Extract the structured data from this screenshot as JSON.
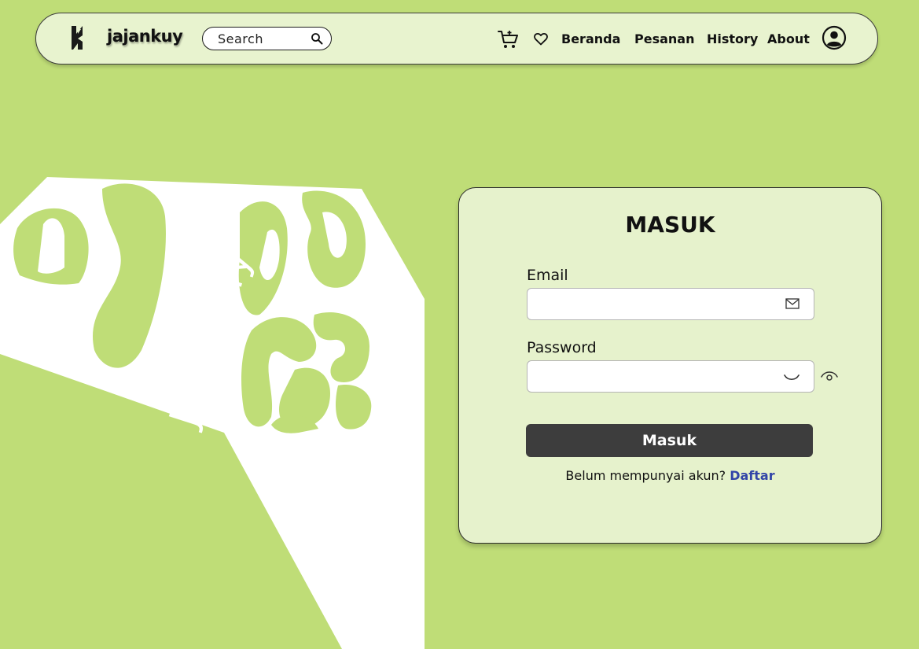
{
  "brand": {
    "name": "jajankuy"
  },
  "search": {
    "placeholder": "Search"
  },
  "nav": {
    "links": [
      "Beranda",
      "Pesanan",
      "History",
      "About"
    ]
  },
  "art": {
    "text": "Jajankuy"
  },
  "login": {
    "title": "MASUK",
    "email_label": "Email",
    "password_label": "Password",
    "submit_label": "Masuk",
    "signup_prompt": "Belum mempunyai akun?",
    "signup_link": "Daftar"
  },
  "colors": {
    "background": "#bfdd77",
    "card": "#e6f2cc",
    "navbar": "#e8f3cf",
    "button": "#3d3d3d",
    "link": "#3245a8"
  }
}
